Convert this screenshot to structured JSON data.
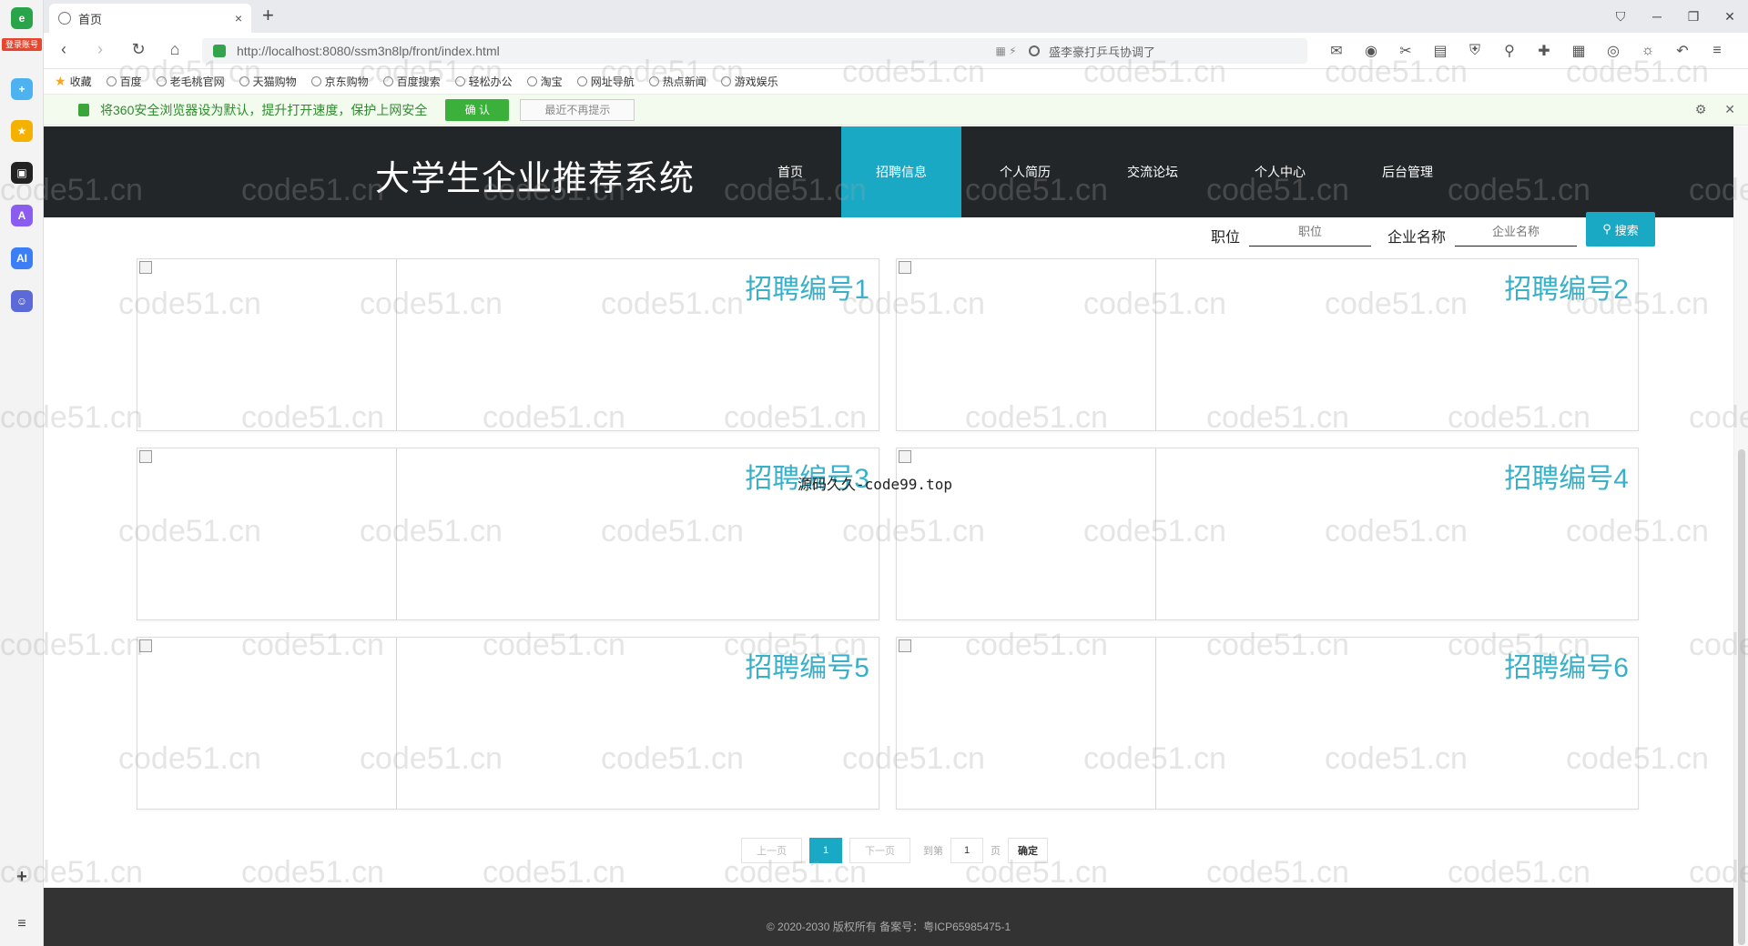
{
  "browser": {
    "tab_title": "首页",
    "tab_close": "×",
    "new_tab": "+",
    "url": "http://localhost:8080/ssm3n8lp/front/index.html",
    "search_text": "盛李豪打乒乓协调了",
    "sidebar_badge": "登录账号",
    "bookmarks": [
      "收藏",
      "百度",
      "老毛桃官网",
      "天猫购物",
      "京东购物",
      "百度搜索",
      "轻松办公",
      "淘宝",
      "网址导航",
      "热点新闻",
      "游戏娱乐"
    ],
    "notice_text": "将360安全浏览器设为默认，提升打开速度，保护上网安全",
    "notice_ok": "确 认",
    "notice_later": "最近不再提示"
  },
  "site": {
    "title": "大学生企业推荐系统",
    "menu": [
      {
        "label": "首页",
        "active": false
      },
      {
        "label": "招聘信息",
        "active": true
      },
      {
        "label": "个人简历",
        "active": false
      },
      {
        "label": "交流论坛",
        "active": false
      },
      {
        "label": "个人中心",
        "active": false
      },
      {
        "label": "后台管理",
        "active": false
      }
    ]
  },
  "filter": {
    "position_label": "职位",
    "position_placeholder": "职位",
    "company_label": "企业名称",
    "company_placeholder": "企业名称",
    "search_button": "搜索"
  },
  "cards": [
    {
      "title": "招聘编号1"
    },
    {
      "title": "招聘编号2"
    },
    {
      "title": "招聘编号3"
    },
    {
      "title": "招聘编号4"
    },
    {
      "title": "招聘编号5"
    },
    {
      "title": "招聘编号6"
    }
  ],
  "overlay_text": "源码久久-code99.top",
  "pager": {
    "prev": "上一页",
    "current": "1",
    "next": "下一页",
    "goto_label": "到第",
    "goto_value": "1",
    "page_unit": "页",
    "confirm": "确定"
  },
  "footer": "© 2020-2030 版权所有 备案号：粤ICP65985475-1",
  "watermark": "code51.cn",
  "colors": {
    "accent": "#1aa9c5",
    "header_bg": "#232629",
    "card_title": "#3ab0c8"
  }
}
